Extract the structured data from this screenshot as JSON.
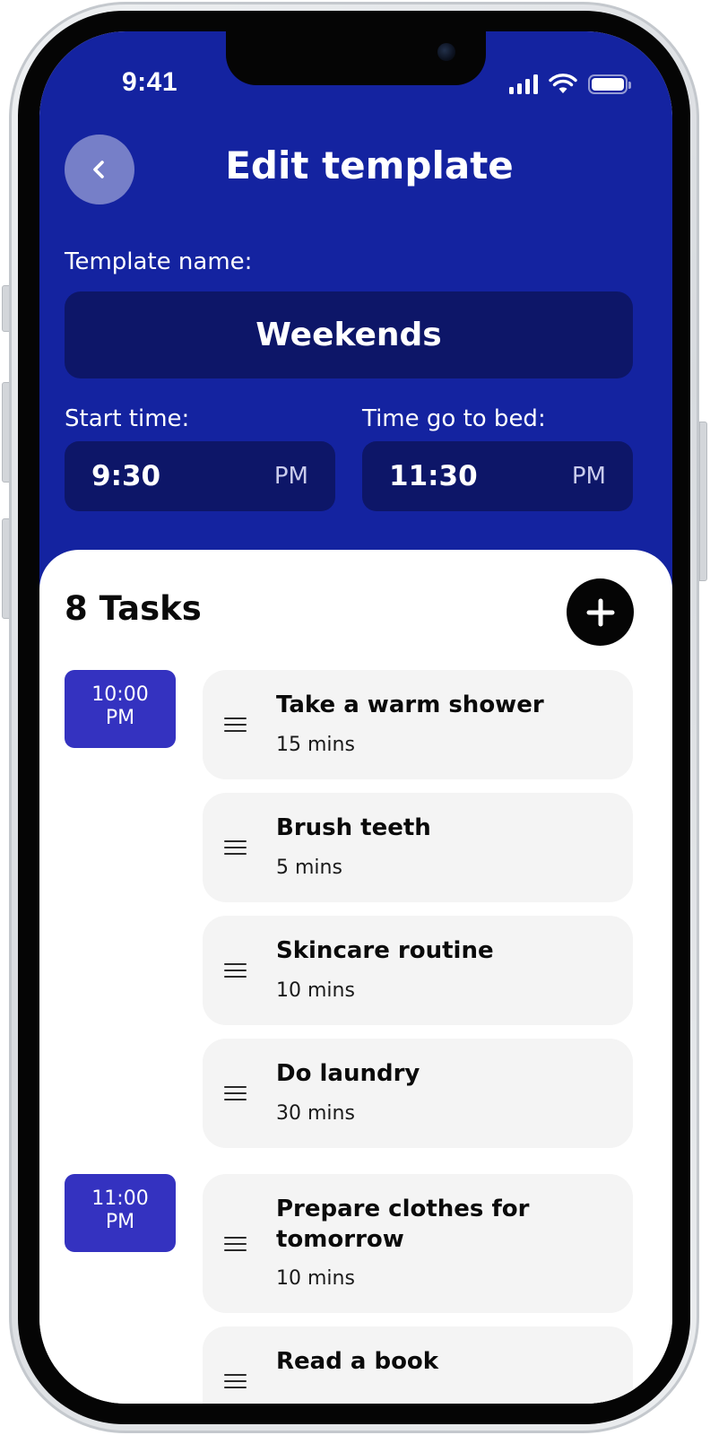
{
  "status_bar": {
    "time": "9:41"
  },
  "header": {
    "title": "Edit template",
    "template_name_label": "Template name:",
    "template_name_value": "Weekends",
    "start_time": {
      "label": "Start time:",
      "value": "9:30",
      "ampm": "PM"
    },
    "bed_time": {
      "label": "Time go to bed:",
      "value": "11:30",
      "ampm": "PM"
    }
  },
  "tasks": {
    "count_label": "8 Tasks",
    "groups": [
      {
        "time": "10:00",
        "ampm": "PM",
        "items": [
          {
            "name": "Take a warm shower",
            "duration": "15 mins"
          },
          {
            "name": "Brush teeth",
            "duration": "5 mins"
          },
          {
            "name": "Skincare routine",
            "duration": "10 mins"
          },
          {
            "name": "Do laundry",
            "duration": "30 mins"
          }
        ]
      },
      {
        "time": "11:00",
        "ampm": "PM",
        "items": [
          {
            "name": "Prepare clothes for tomorrow",
            "duration": "10 mins"
          },
          {
            "name": "Read a book",
            "duration": ""
          }
        ]
      }
    ]
  },
  "icons": {
    "back": "chevron-left-icon",
    "add": "plus-icon",
    "drag": "drag-handle-icon",
    "signal": "cellular-signal-icon",
    "wifi": "wifi-icon",
    "battery": "battery-icon"
  },
  "colors": {
    "header_bg": "#1423a0",
    "field_bg": "#0d1668",
    "time_badge_bg": "#3432c0",
    "card_bg": "#f4f4f4",
    "add_button_bg": "#050505"
  }
}
